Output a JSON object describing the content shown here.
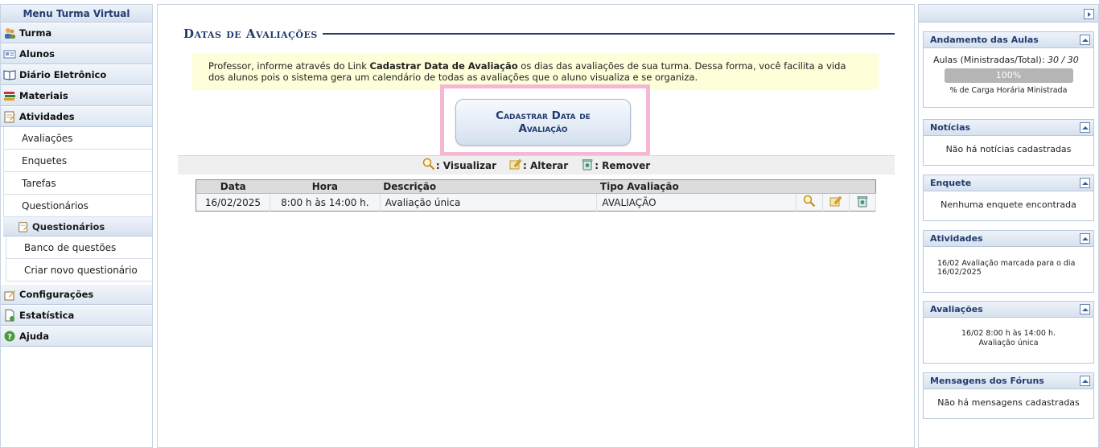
{
  "left_menu": {
    "title": "Menu Turma Virtual",
    "sections": {
      "turma": "Turma",
      "alunos": "Alunos",
      "diario": "Diário Eletrônico",
      "materiais": "Materiais",
      "atividades": "Atividades",
      "configuracoes": "Configurações",
      "estatistica": "Estatística",
      "ajuda": "Ajuda"
    },
    "atividades_items": [
      "Avaliações",
      "Enquetes",
      "Tarefas",
      "Questionários"
    ],
    "questionarios_sub": {
      "label": "Questionários",
      "items": [
        "Banco de questões",
        "Criar novo questionário"
      ]
    }
  },
  "main": {
    "page_title": "Datas de Avaliações",
    "info_prefix": "Professor, informe através do Link ",
    "info_link": "Cadastrar Data de Avaliação",
    "info_suffix": " os dias das avaliações de sua turma. Dessa forma, você facilita a vida dos alunos pois o sistema gera um calendário de todas as avaliações que o aluno visualiza e se organiza.",
    "cadastrar_button": "Cadastrar Data de Avaliação",
    "legend": {
      "visualizar": ": Visualizar",
      "alterar": ": Alterar",
      "remover": ": Remover"
    },
    "table": {
      "headers": [
        "Data",
        "Hora",
        "Descrição",
        "Tipo Avaliação"
      ],
      "rows": [
        {
          "data": "16/02/2025",
          "hora": "8:00 h às 14:00 h.",
          "descricao": "Avaliação única",
          "tipo": "AVALIAÇÃO"
        }
      ]
    }
  },
  "right_panel": {
    "andamento": {
      "title": "Andamento das Aulas",
      "label": "Aulas (Ministradas/Total):",
      "value": "30 / 30",
      "progress_text": "100%",
      "progress_fraction": 1.0,
      "caption": "% de Carga Horária Ministrada"
    },
    "noticias": {
      "title": "Notícias",
      "body": "Não há notícias cadastradas"
    },
    "enquete": {
      "title": "Enquete",
      "body": "Nenhuma enquete encontrada"
    },
    "atividades": {
      "title": "Atividades",
      "date": "16/02",
      "text": "Avaliação marcada para o dia 16/02/2025"
    },
    "avaliacoes": {
      "title": "Avaliações",
      "line1": "16/02 8:00 h às 14:00 h.",
      "line2": "Avaliação única"
    },
    "mensagens": {
      "title": "Mensagens dos Fóruns",
      "body": "Não há mensagens cadastradas"
    }
  },
  "colors": {
    "accent": "#223c6e",
    "info_bg": "#fefed9",
    "highlight_border": "#f5b8d4"
  }
}
